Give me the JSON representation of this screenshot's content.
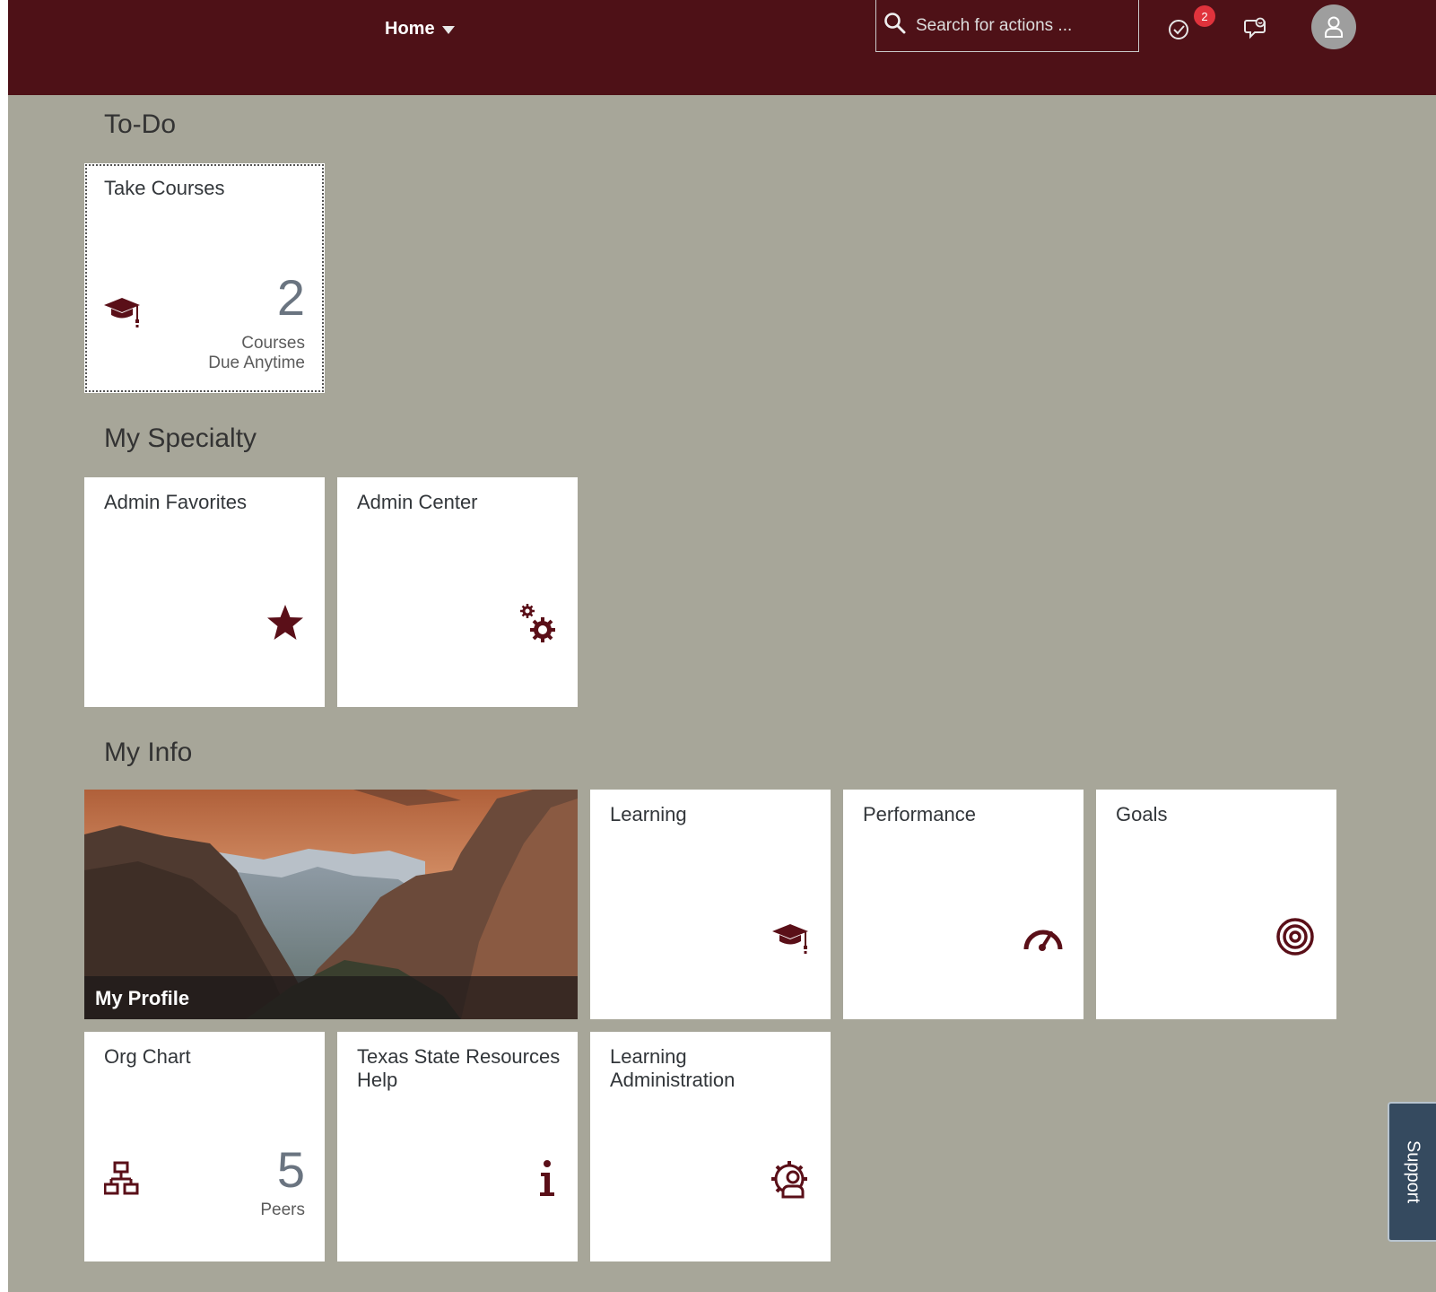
{
  "header": {
    "home_label": "Home",
    "search_placeholder": "Search for actions ...",
    "notifications_count": "2"
  },
  "sections": {
    "todo": {
      "title": "To-Do"
    },
    "specialty": {
      "title": "My Specialty"
    },
    "info": {
      "title": "My Info"
    }
  },
  "tiles": {
    "take_courses": {
      "title": "Take Courses",
      "number": "2",
      "sub1": "Courses",
      "sub2": "Due Anytime",
      "icon": "graduation-cap-icon"
    },
    "admin_favorites": {
      "title": "Admin Favorites",
      "icon": "star-icon"
    },
    "admin_center": {
      "title": "Admin Center",
      "icon": "gears-icon"
    },
    "my_profile": {
      "title": "My Profile"
    },
    "learning": {
      "title": "Learning",
      "icon": "graduation-cap-icon"
    },
    "performance": {
      "title": "Performance",
      "icon": "speedometer-icon"
    },
    "goals": {
      "title": "Goals",
      "icon": "target-icon"
    },
    "org_chart": {
      "title": "Org Chart",
      "number": "5",
      "sub1": "Peers",
      "icon": "org-chart-icon"
    },
    "resources_help": {
      "title": "Texas State Resources Help",
      "icon": "info-icon"
    },
    "learning_admin": {
      "title": "Learning Administration",
      "icon": "gear-person-icon"
    }
  },
  "support": {
    "label": "Support"
  },
  "colors": {
    "header_bg": "#4e1117",
    "page_bg": "#a7a699",
    "icon_maroon": "#5a0f18",
    "badge_red": "#e0333c",
    "support_bg": "#354a5f"
  }
}
